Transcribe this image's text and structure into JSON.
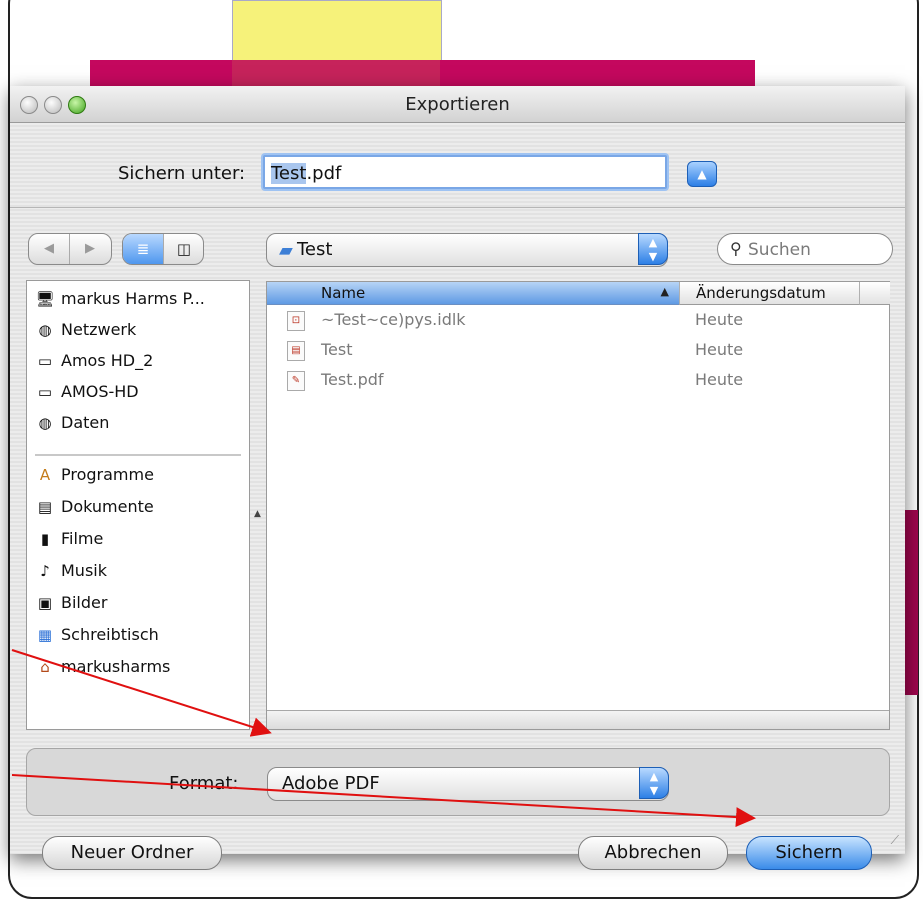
{
  "dialog": {
    "title": "Exportieren",
    "save_as_label": "Sichern unter:",
    "filename_selected": "Test",
    "filename_ext": ".pdf",
    "current_folder": "Test",
    "search_placeholder": "Suchen"
  },
  "sidebar": {
    "devices": [
      {
        "icon": "computer-icon",
        "glyph": "🖥",
        "label": "markus Harms P..."
      },
      {
        "icon": "network-icon",
        "glyph": "◍",
        "label": "Netzwerk"
      },
      {
        "icon": "disk-icon",
        "glyph": "▭",
        "label": "Amos HD_2"
      },
      {
        "icon": "disk-icon",
        "glyph": "▭",
        "label": "AMOS-HD"
      },
      {
        "icon": "server-icon",
        "glyph": "◍",
        "label": "Daten"
      }
    ],
    "places": [
      {
        "icon": "applications-icon",
        "glyph": "A",
        "label": "Programme"
      },
      {
        "icon": "documents-icon",
        "glyph": "▤",
        "label": "Dokumente"
      },
      {
        "icon": "movies-icon",
        "glyph": "▮",
        "label": "Filme"
      },
      {
        "icon": "music-icon",
        "glyph": "♪",
        "label": "Musik"
      },
      {
        "icon": "pictures-icon",
        "glyph": "▣",
        "label": "Bilder"
      },
      {
        "icon": "desktop-icon",
        "glyph": "▦",
        "label": "Schreibtisch"
      },
      {
        "icon": "home-icon",
        "glyph": "⌂",
        "label": "markusharms"
      }
    ]
  },
  "file_list": {
    "columns": {
      "name": "Name",
      "date": "Änderungsdatum"
    },
    "rows": [
      {
        "icon": "locked-file-icon",
        "name": "~Test~ce)pys.idlk",
        "date": "Heute"
      },
      {
        "icon": "document-icon",
        "name": "Test",
        "date": "Heute"
      },
      {
        "icon": "pdf-icon",
        "name": "Test.pdf",
        "date": "Heute"
      }
    ]
  },
  "format": {
    "label": "Format:",
    "value": "Adobe PDF"
  },
  "buttons": {
    "new_folder": "Neuer Ordner",
    "cancel": "Abbrechen",
    "save": "Sichern"
  },
  "colors": {
    "accent": "#3a8be9",
    "annotation_arrow": "#e01010"
  }
}
